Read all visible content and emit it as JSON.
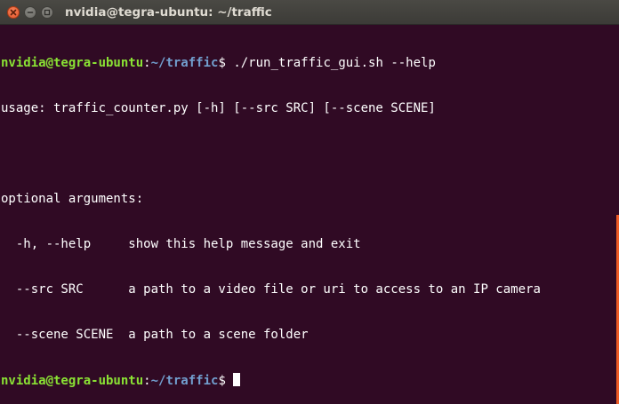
{
  "window": {
    "title": "nvidia@tegra-ubuntu: ~/traffic"
  },
  "colors": {
    "background": "#300a24",
    "prompt_user": "#8ae234",
    "prompt_path": "#729fcf",
    "text": "#ffffff",
    "scrollbar": "#ee5c26"
  },
  "icons": {
    "close": "close-icon",
    "minimize": "minimize-icon",
    "maximize": "maximize-icon"
  },
  "terminal": {
    "prompt1": {
      "user_host": "nvidia@tegra-ubuntu",
      "colon": ":",
      "path": "~/traffic",
      "dollar": "$ ",
      "command": "./run_traffic_gui.sh --help"
    },
    "output": [
      "usage: traffic_counter.py [-h] [--src SRC] [--scene SCENE]",
      "",
      "optional arguments:",
      "  -h, --help     show this help message and exit",
      "  --src SRC      a path to a video file or uri to access to an IP camera",
      "  --scene SCENE  a path to a scene folder"
    ],
    "prompt2": {
      "user_host": "nvidia@tegra-ubuntu",
      "colon": ":",
      "path": "~/traffic",
      "dollar": "$ "
    }
  }
}
